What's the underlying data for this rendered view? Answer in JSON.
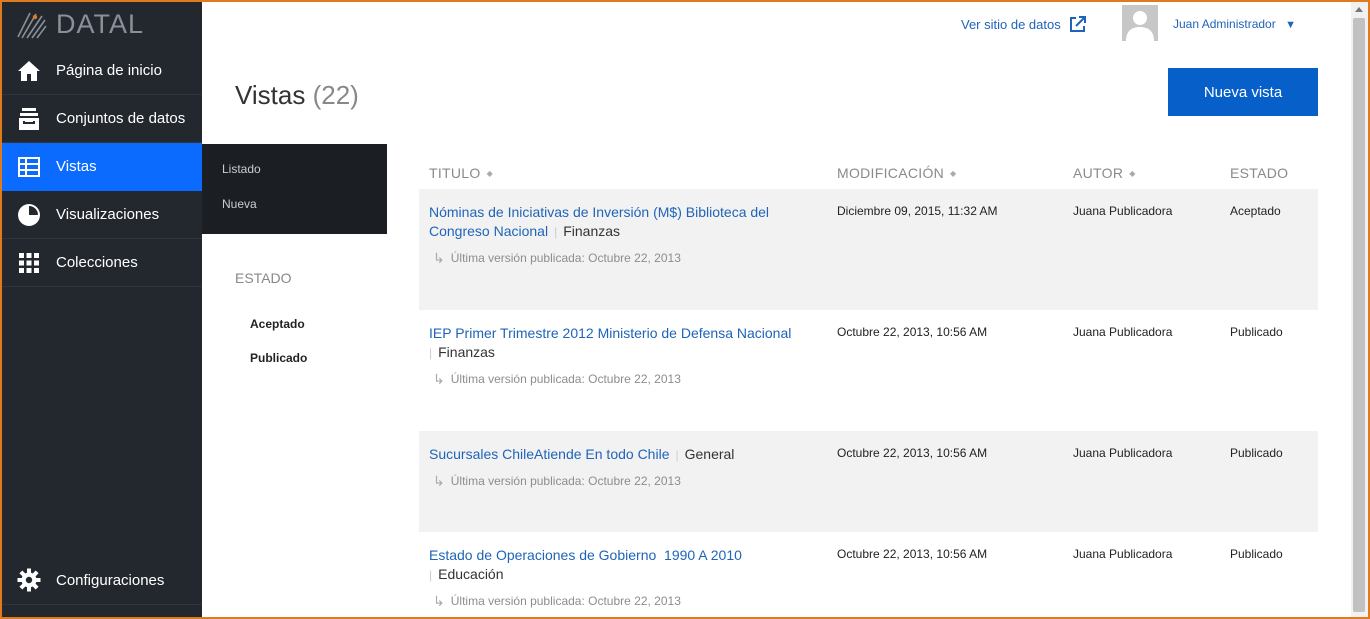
{
  "app": {
    "logo_text": "DATAL",
    "brand_color": "#0b6bff",
    "sidebar_color": "#23282f"
  },
  "sidebar": {
    "items": [
      {
        "label": "Página de inicio",
        "icon": "home-icon"
      },
      {
        "label": "Conjuntos de datos",
        "icon": "dataset-icon"
      },
      {
        "label": "Vistas",
        "icon": "table-icon",
        "active": true
      },
      {
        "label": "Visualizaciones",
        "icon": "pie-chart-icon"
      },
      {
        "label": "Colecciones",
        "icon": "grid-icon"
      }
    ],
    "settings_label": "Configuraciones"
  },
  "submenu": {
    "items": [
      "Listado",
      "Nueva"
    ]
  },
  "header": {
    "external_link": "Ver sitio de datos",
    "user_name": "Juan Administrador",
    "user_caret": "▼"
  },
  "page": {
    "title": "Vistas",
    "count": "(22)",
    "new_button": "Nueva vista"
  },
  "filters": {
    "heading": "ESTADO",
    "items": [
      "Aceptado",
      "Publicado"
    ]
  },
  "table": {
    "headers": {
      "title": "TITULO",
      "modified": "MODIFICACIÓN",
      "author": "AUTOR",
      "status": "ESTADO"
    },
    "sort_glyph": "◆",
    "pub_arrow": "↳",
    "rows": [
      {
        "title": "Nóminas de Iniciativas de Inversión (M$) Biblioteca del Congreso Nacional",
        "category": "Finanzas",
        "published": "Última versión publicada: Octubre 22, 2013",
        "modified": "Diciembre 09, 2015, 11:32 AM",
        "author": "Juana Publicadora",
        "status": "Aceptado"
      },
      {
        "title": "IEP Primer Trimestre 2012 Ministerio de Defensa Nacional",
        "category": "Finanzas",
        "published": "Última versión publicada: Octubre 22, 2013",
        "modified": "Octubre 22, 2013, 10:56 AM",
        "author": "Juana Publicadora",
        "status": "Publicado"
      },
      {
        "title": "Sucursales ChileAtiende En todo Chile",
        "category": "General",
        "published": "Última versión publicada: Octubre 22, 2013",
        "modified": "Octubre 22, 2013, 10:56 AM",
        "author": "Juana Publicadora",
        "status": "Publicado"
      },
      {
        "title": "Estado de Operaciones de Gobierno  1990 A 2010",
        "category": "Educación",
        "published": "Última versión publicada: Octubre 22, 2013",
        "modified": "Octubre 22, 2013, 10:56 AM",
        "author": "Juana Publicadora",
        "status": "Publicado"
      }
    ]
  }
}
